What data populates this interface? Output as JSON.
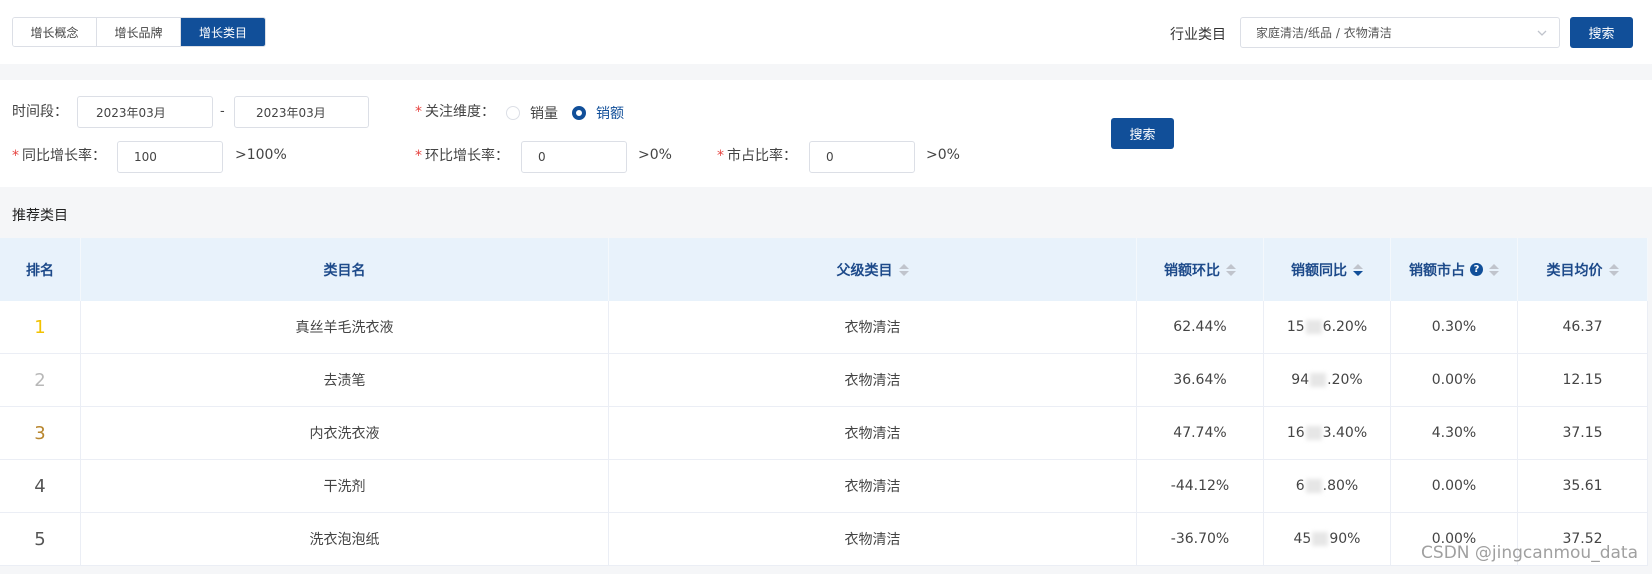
{
  "tabs": [
    {
      "label": "增长概念",
      "active": false
    },
    {
      "label": "增长品牌",
      "active": false
    },
    {
      "label": "增长类目",
      "active": true
    }
  ],
  "industry": {
    "label": "行业类目",
    "value": "家庭清洁/纸品 / 衣物清洁",
    "search_label": "搜索"
  },
  "filters": {
    "period_label": "时间段：",
    "period_start": "2023年03月",
    "period_sep": "-",
    "period_end": "2023年03月",
    "dimension_label": "关注维度：",
    "dimension_options": [
      "销量",
      "销额"
    ],
    "dimension_selected": "销额",
    "yoy_label": "同比增长率：",
    "yoy_value": "100",
    "yoy_suffix": ">100%",
    "mom_label": "环比增长率：",
    "mom_value": "0",
    "mom_suffix": ">0%",
    "share_label": "市占比率：",
    "share_value": "0",
    "share_suffix": ">0%",
    "search_label": "搜索"
  },
  "section_title": "推荐类目",
  "table": {
    "columns": [
      "排名",
      "类目名",
      "父级类目",
      "销额环比",
      "销额同比",
      "销额市占",
      "类目均价"
    ],
    "rows": [
      {
        "rank": "1",
        "rank_color": "#f2c200",
        "name": "真丝羊毛洗衣液",
        "parent": "衣物清洁",
        "mom": "62.44%",
        "yoy_a": "15",
        "yoy_b": "6.20%",
        "share": "0.30%",
        "price": "46.37"
      },
      {
        "rank": "2",
        "rank_color": "#b8b8b8",
        "name": "去渍笔",
        "parent": "衣物清洁",
        "mom": "36.64%",
        "yoy_a": "94",
        "yoy_b": ".20%",
        "share": "0.00%",
        "price": "12.15"
      },
      {
        "rank": "3",
        "rank_color": "#b8862e",
        "name": "内衣洗衣液",
        "parent": "衣物清洁",
        "mom": "47.74%",
        "yoy_a": "16",
        "yoy_b": "3.40%",
        "share": "4.30%",
        "price": "37.15"
      },
      {
        "rank": "4",
        "rank_color": "#555555",
        "name": "干洗剂",
        "parent": "衣物清洁",
        "mom": "-44.12%",
        "yoy_a": "6",
        "yoy_b": ".80%",
        "share": "0.00%",
        "price": "35.61"
      },
      {
        "rank": "5",
        "rank_color": "#555555",
        "name": "洗衣泡泡纸",
        "parent": "衣物清洁",
        "mom": "-36.70%",
        "yoy_a": "45",
        "yoy_b": "90%",
        "share": "0.00%",
        "price": "37.52"
      }
    ]
  },
  "watermark": "CSDN @jingcanmou_data",
  "icons": {
    "select_chevron": "chevron-down-icon",
    "help": "question-circle-icon",
    "sort": "sort-caret-icon"
  },
  "colors": {
    "primary": "#114f99",
    "header_bg": "#e8f2fb",
    "required": "#e64340"
  }
}
